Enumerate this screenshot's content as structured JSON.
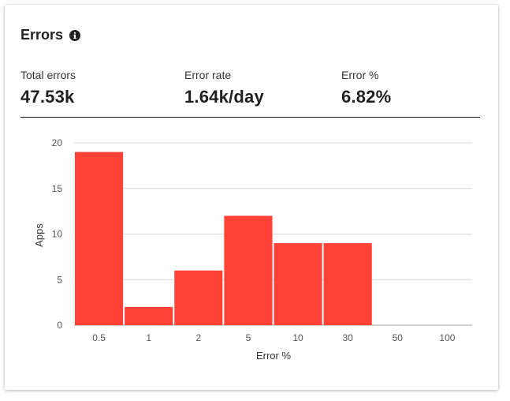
{
  "header": {
    "title": "Errors",
    "info_icon": "info-circle-icon"
  },
  "metrics": [
    {
      "label": "Total errors",
      "value": "47.53k"
    },
    {
      "label": "Error rate",
      "value": "1.64k/day"
    },
    {
      "label": "Error %",
      "value": "6.82%"
    }
  ],
  "colors": {
    "bar": "#ff4136",
    "grid": "#d8d8d8",
    "axis": "#a0a0a0",
    "tick_text": "#555555"
  },
  "chart_data": {
    "type": "bar",
    "categories": [
      "0.5",
      "1",
      "2",
      "5",
      "10",
      "30",
      "50",
      "100"
    ],
    "values": [
      19,
      2,
      6,
      12,
      9,
      9,
      0,
      0
    ],
    "xlabel": "Error %",
    "ylabel": "Apps",
    "ylim": [
      0,
      20
    ],
    "yticks": [
      0,
      5,
      10,
      15,
      20
    ],
    "grid": true
  }
}
